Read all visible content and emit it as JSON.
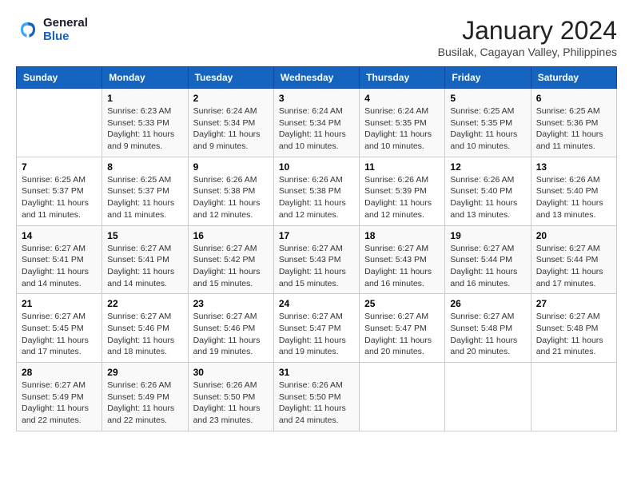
{
  "logo": {
    "text_general": "General",
    "text_blue": "Blue"
  },
  "title": "January 2024",
  "subtitle": "Busilak, Cagayan Valley, Philippines",
  "headers": [
    "Sunday",
    "Monday",
    "Tuesday",
    "Wednesday",
    "Thursday",
    "Friday",
    "Saturday"
  ],
  "weeks": [
    [
      {
        "day": "",
        "sunrise": "",
        "sunset": "",
        "daylight": ""
      },
      {
        "day": "1",
        "sunrise": "Sunrise: 6:23 AM",
        "sunset": "Sunset: 5:33 PM",
        "daylight": "Daylight: 11 hours and 9 minutes."
      },
      {
        "day": "2",
        "sunrise": "Sunrise: 6:24 AM",
        "sunset": "Sunset: 5:34 PM",
        "daylight": "Daylight: 11 hours and 9 minutes."
      },
      {
        "day": "3",
        "sunrise": "Sunrise: 6:24 AM",
        "sunset": "Sunset: 5:34 PM",
        "daylight": "Daylight: 11 hours and 10 minutes."
      },
      {
        "day": "4",
        "sunrise": "Sunrise: 6:24 AM",
        "sunset": "Sunset: 5:35 PM",
        "daylight": "Daylight: 11 hours and 10 minutes."
      },
      {
        "day": "5",
        "sunrise": "Sunrise: 6:25 AM",
        "sunset": "Sunset: 5:35 PM",
        "daylight": "Daylight: 11 hours and 10 minutes."
      },
      {
        "day": "6",
        "sunrise": "Sunrise: 6:25 AM",
        "sunset": "Sunset: 5:36 PM",
        "daylight": "Daylight: 11 hours and 11 minutes."
      }
    ],
    [
      {
        "day": "7",
        "sunrise": "Sunrise: 6:25 AM",
        "sunset": "Sunset: 5:37 PM",
        "daylight": "Daylight: 11 hours and 11 minutes."
      },
      {
        "day": "8",
        "sunrise": "Sunrise: 6:25 AM",
        "sunset": "Sunset: 5:37 PM",
        "daylight": "Daylight: 11 hours and 11 minutes."
      },
      {
        "day": "9",
        "sunrise": "Sunrise: 6:26 AM",
        "sunset": "Sunset: 5:38 PM",
        "daylight": "Daylight: 11 hours and 12 minutes."
      },
      {
        "day": "10",
        "sunrise": "Sunrise: 6:26 AM",
        "sunset": "Sunset: 5:38 PM",
        "daylight": "Daylight: 11 hours and 12 minutes."
      },
      {
        "day": "11",
        "sunrise": "Sunrise: 6:26 AM",
        "sunset": "Sunset: 5:39 PM",
        "daylight": "Daylight: 11 hours and 12 minutes."
      },
      {
        "day": "12",
        "sunrise": "Sunrise: 6:26 AM",
        "sunset": "Sunset: 5:40 PM",
        "daylight": "Daylight: 11 hours and 13 minutes."
      },
      {
        "day": "13",
        "sunrise": "Sunrise: 6:26 AM",
        "sunset": "Sunset: 5:40 PM",
        "daylight": "Daylight: 11 hours and 13 minutes."
      }
    ],
    [
      {
        "day": "14",
        "sunrise": "Sunrise: 6:27 AM",
        "sunset": "Sunset: 5:41 PM",
        "daylight": "Daylight: 11 hours and 14 minutes."
      },
      {
        "day": "15",
        "sunrise": "Sunrise: 6:27 AM",
        "sunset": "Sunset: 5:41 PM",
        "daylight": "Daylight: 11 hours and 14 minutes."
      },
      {
        "day": "16",
        "sunrise": "Sunrise: 6:27 AM",
        "sunset": "Sunset: 5:42 PM",
        "daylight": "Daylight: 11 hours and 15 minutes."
      },
      {
        "day": "17",
        "sunrise": "Sunrise: 6:27 AM",
        "sunset": "Sunset: 5:43 PM",
        "daylight": "Daylight: 11 hours and 15 minutes."
      },
      {
        "day": "18",
        "sunrise": "Sunrise: 6:27 AM",
        "sunset": "Sunset: 5:43 PM",
        "daylight": "Daylight: 11 hours and 16 minutes."
      },
      {
        "day": "19",
        "sunrise": "Sunrise: 6:27 AM",
        "sunset": "Sunset: 5:44 PM",
        "daylight": "Daylight: 11 hours and 16 minutes."
      },
      {
        "day": "20",
        "sunrise": "Sunrise: 6:27 AM",
        "sunset": "Sunset: 5:44 PM",
        "daylight": "Daylight: 11 hours and 17 minutes."
      }
    ],
    [
      {
        "day": "21",
        "sunrise": "Sunrise: 6:27 AM",
        "sunset": "Sunset: 5:45 PM",
        "daylight": "Daylight: 11 hours and 17 minutes."
      },
      {
        "day": "22",
        "sunrise": "Sunrise: 6:27 AM",
        "sunset": "Sunset: 5:46 PM",
        "daylight": "Daylight: 11 hours and 18 minutes."
      },
      {
        "day": "23",
        "sunrise": "Sunrise: 6:27 AM",
        "sunset": "Sunset: 5:46 PM",
        "daylight": "Daylight: 11 hours and 19 minutes."
      },
      {
        "day": "24",
        "sunrise": "Sunrise: 6:27 AM",
        "sunset": "Sunset: 5:47 PM",
        "daylight": "Daylight: 11 hours and 19 minutes."
      },
      {
        "day": "25",
        "sunrise": "Sunrise: 6:27 AM",
        "sunset": "Sunset: 5:47 PM",
        "daylight": "Daylight: 11 hours and 20 minutes."
      },
      {
        "day": "26",
        "sunrise": "Sunrise: 6:27 AM",
        "sunset": "Sunset: 5:48 PM",
        "daylight": "Daylight: 11 hours and 20 minutes."
      },
      {
        "day": "27",
        "sunrise": "Sunrise: 6:27 AM",
        "sunset": "Sunset: 5:48 PM",
        "daylight": "Daylight: 11 hours and 21 minutes."
      }
    ],
    [
      {
        "day": "28",
        "sunrise": "Sunrise: 6:27 AM",
        "sunset": "Sunset: 5:49 PM",
        "daylight": "Daylight: 11 hours and 22 minutes."
      },
      {
        "day": "29",
        "sunrise": "Sunrise: 6:26 AM",
        "sunset": "Sunset: 5:49 PM",
        "daylight": "Daylight: 11 hours and 22 minutes."
      },
      {
        "day": "30",
        "sunrise": "Sunrise: 6:26 AM",
        "sunset": "Sunset: 5:50 PM",
        "daylight": "Daylight: 11 hours and 23 minutes."
      },
      {
        "day": "31",
        "sunrise": "Sunrise: 6:26 AM",
        "sunset": "Sunset: 5:50 PM",
        "daylight": "Daylight: 11 hours and 24 minutes."
      },
      {
        "day": "",
        "sunrise": "",
        "sunset": "",
        "daylight": ""
      },
      {
        "day": "",
        "sunrise": "",
        "sunset": "",
        "daylight": ""
      },
      {
        "day": "",
        "sunrise": "",
        "sunset": "",
        "daylight": ""
      }
    ]
  ]
}
